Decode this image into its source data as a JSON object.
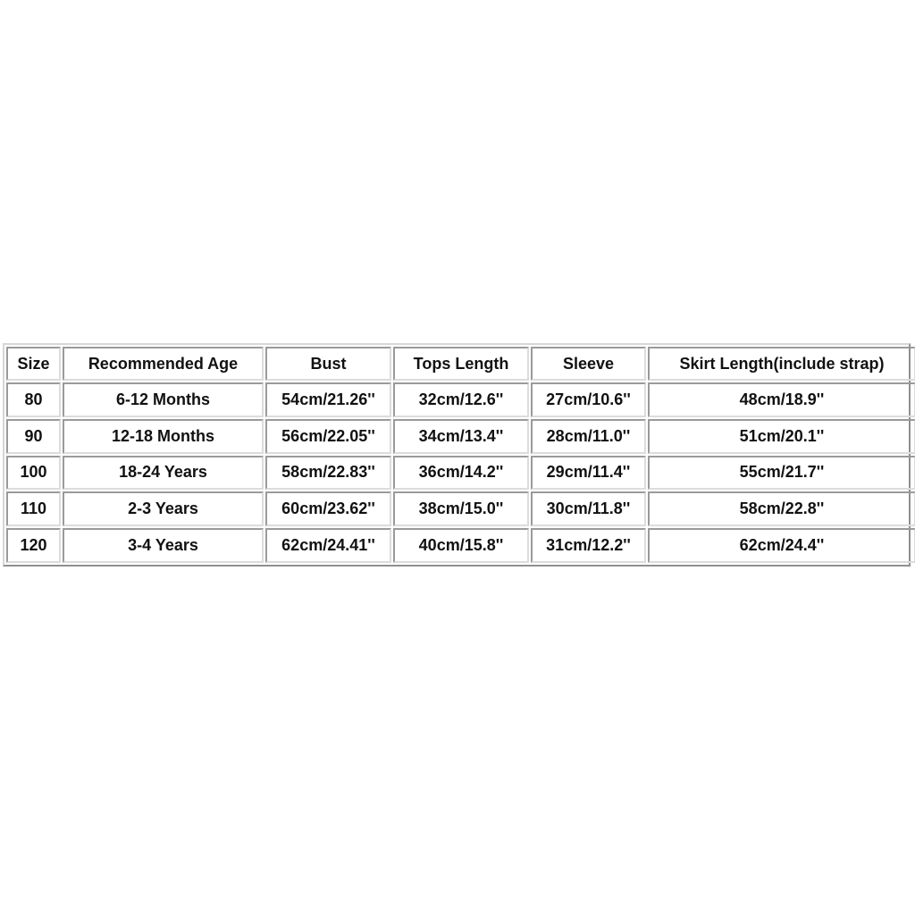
{
  "size_chart": {
    "headers": [
      "Size",
      "Recommended Age",
      "Bust",
      "Tops Length",
      "Sleeve",
      "Skirt Length(include strap)"
    ],
    "rows": [
      [
        "80",
        "6-12 Months",
        "54cm/21.26''",
        "32cm/12.6''",
        "27cm/10.6''",
        "48cm/18.9''"
      ],
      [
        "90",
        "12-18 Months",
        "56cm/22.05''",
        "34cm/13.4''",
        "28cm/11.0''",
        "51cm/20.1''"
      ],
      [
        "100",
        "18-24 Years",
        "58cm/22.83''",
        "36cm/14.2''",
        "29cm/11.4''",
        "55cm/21.7''"
      ],
      [
        "110",
        "2-3 Years",
        "60cm/23.62''",
        "38cm/15.0''",
        "30cm/11.8''",
        "58cm/22.8''"
      ],
      [
        "120",
        "3-4 Years",
        "62cm/24.41''",
        "40cm/15.8''",
        "31cm/12.2''",
        "62cm/24.4''"
      ]
    ]
  },
  "colors": {
    "background": "#ffffff",
    "text": "#111111",
    "border_dark": "#9a9a9a",
    "border_light": "#dcdcdc"
  }
}
